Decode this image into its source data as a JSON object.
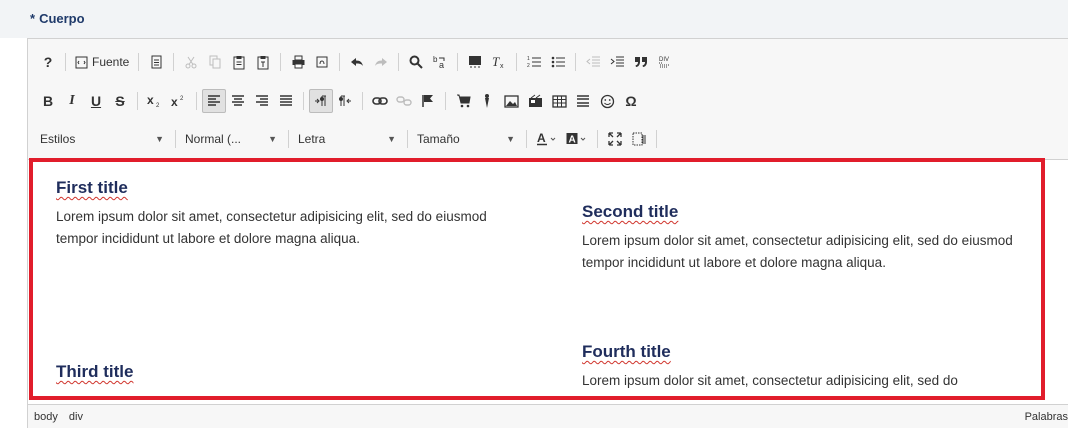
{
  "field": {
    "required_mark": "*",
    "label": "Cuerpo"
  },
  "toolbar": {
    "help": "?",
    "source": "Fuente",
    "styles_label": "Estilos",
    "format_label": "Normal (...",
    "font_label": "Letra",
    "size_label": "Tamaño"
  },
  "content": {
    "blocks": [
      {
        "title": "First title",
        "body": "Lorem ipsum dolor sit amet, consectetur adipisicing elit, sed do eiusmod tempor incididunt ut labore et dolore magna aliqua."
      },
      {
        "title": "Second title",
        "body": "Lorem ipsum dolor sit amet, consectetur adipisicing elit, sed do eiusmod tempor incididunt ut labore et dolore magna aliqua."
      },
      {
        "title": "Third title",
        "body": ""
      },
      {
        "title": "Fourth title",
        "body": "Lorem ipsum dolor sit amet, consectetur adipisicing elit, sed do"
      }
    ]
  },
  "statusbar": {
    "path": [
      "body",
      "div"
    ],
    "words": "Palabras"
  },
  "colors": {
    "title": "#1f2d5c",
    "highlight": "#e11d2b",
    "label": "#1f3a6a"
  }
}
